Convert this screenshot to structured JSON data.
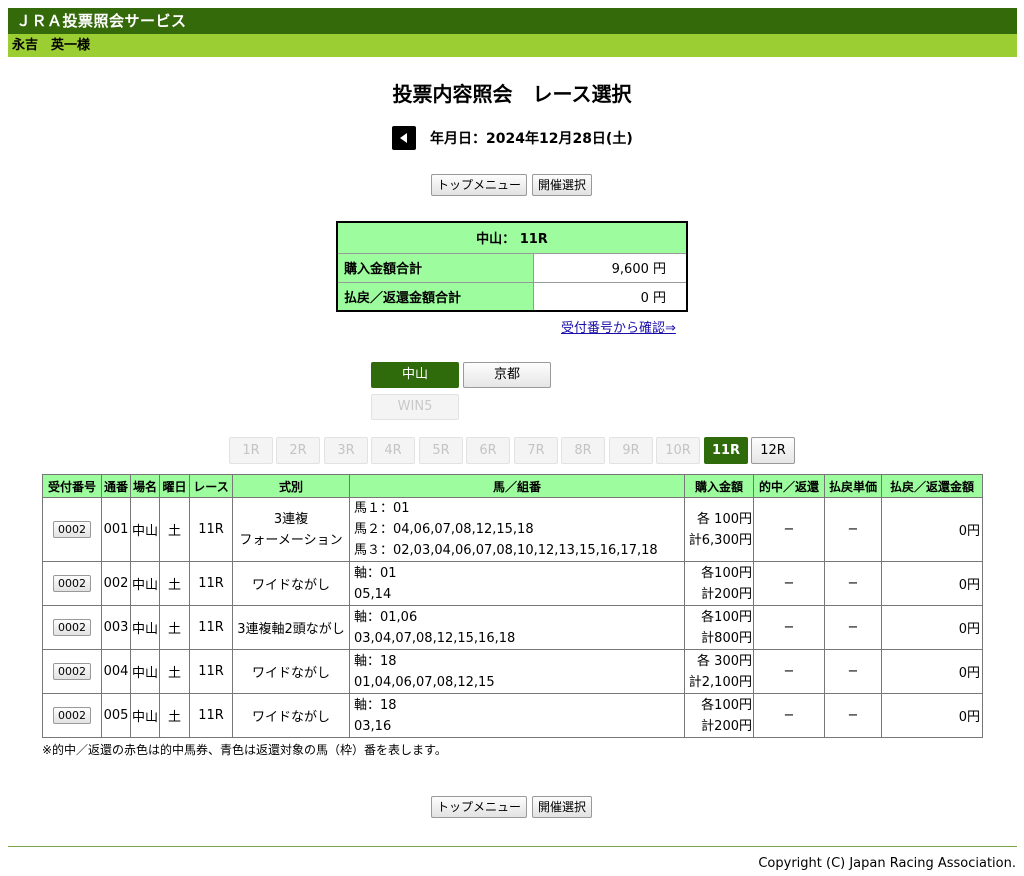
{
  "header": {
    "service_name": "ＪＲＡ投票照会サービス",
    "user_name": "永吉　英一様"
  },
  "page": {
    "title": "投票内容照会　レース選択",
    "date_label": "年月日：2024年12月28日(土)"
  },
  "nav": {
    "top_menu": "トップメニュー",
    "meeting_select": "開催選択"
  },
  "summary": {
    "venue_race": "中山： 11R",
    "purchase_total_label": "購入金額合計",
    "purchase_total_value": "9,600 円",
    "payout_total_label": "払戻／返還金額合計",
    "payout_total_value": "0 円",
    "confirm_link": "受付番号から確認⇒"
  },
  "venues": {
    "nakayama": "中山",
    "kyoto": "京都",
    "win5": "WIN5"
  },
  "races": [
    "1R",
    "2R",
    "3R",
    "4R",
    "5R",
    "6R",
    "7R",
    "8R",
    "9R",
    "10R",
    "11R",
    "12R"
  ],
  "table": {
    "headers": {
      "receipt_no": "受付番号",
      "serial": "通番",
      "venue": "場名",
      "day": "曜日",
      "race": "レース",
      "bet_type": "式別",
      "combination": "馬／組番",
      "amount": "購入金額",
      "hit": "的中／返還",
      "unit_payout": "払戻単価",
      "payout": "払戻／返還金額"
    },
    "rows": [
      {
        "receipt": "0002",
        "serial": "001",
        "venue": "中山",
        "day": "土",
        "race": "11R",
        "bet_type_1": "3連複",
        "bet_type_2": "フォーメーション",
        "combo_1": "馬１：01",
        "combo_2": "馬２：04,06,07,08,12,15,18",
        "combo_3": "馬３：02,03,04,06,07,08,10,12,13,15,16,17,18",
        "amount_each": "各 100円",
        "amount_total": "計6,300円",
        "hit": "−",
        "unit_payout": "−",
        "payout": "0円"
      },
      {
        "receipt": "0002",
        "serial": "002",
        "venue": "中山",
        "day": "土",
        "race": "11R",
        "bet_type": "ワイドながし",
        "combo_1": "軸：01",
        "combo_2": "05,14",
        "amount_each": "各100円",
        "amount_total": "計200円",
        "hit": "−",
        "unit_payout": "−",
        "payout": "0円"
      },
      {
        "receipt": "0002",
        "serial": "003",
        "venue": "中山",
        "day": "土",
        "race": "11R",
        "bet_type": "3連複軸2頭ながし",
        "combo_1": "軸：01,06",
        "combo_2": "03,04,07,08,12,15,16,18",
        "amount_each": "各100円",
        "amount_total": "計800円",
        "hit": "−",
        "unit_payout": "−",
        "payout": "0円"
      },
      {
        "receipt": "0002",
        "serial": "004",
        "venue": "中山",
        "day": "土",
        "race": "11R",
        "bet_type": "ワイドながし",
        "combo_1": "軸：18",
        "combo_2": "01,04,06,07,08,12,15",
        "amount_each": "各 300円",
        "amount_total": "計2,100円",
        "hit": "−",
        "unit_payout": "−",
        "payout": "0円"
      },
      {
        "receipt": "0002",
        "serial": "005",
        "venue": "中山",
        "day": "土",
        "race": "11R",
        "bet_type": "ワイドながし",
        "combo_1": "軸：18",
        "combo_2": "03,16",
        "amount_each": "各100円",
        "amount_total": "計200円",
        "hit": "−",
        "unit_payout": "−",
        "payout": "0円"
      }
    ]
  },
  "note": "※的中／返還の赤色は的中馬券、青色は返還対象の馬（枠）番を表します。",
  "footer": {
    "copyright": "Copyright (C) Japan Racing Association."
  },
  "colors": {
    "header_dark": "#356a0b",
    "header_light": "#9bce33",
    "table_header": "#9dfc9d",
    "active_tab": "#2f6a0b"
  }
}
